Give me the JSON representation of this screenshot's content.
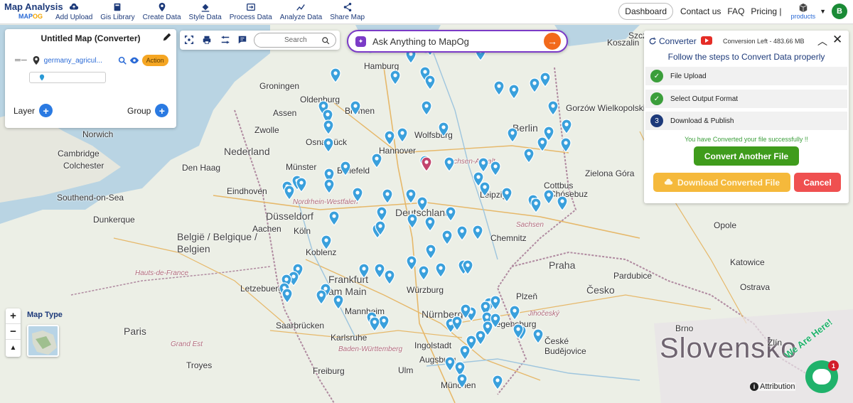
{
  "brand": {
    "title": "Map Analysis",
    "sub_prefix": "MAP",
    "sub_suffix": "OG"
  },
  "nav": [
    {
      "label": "Add Upload",
      "icon": "cloud-upload-icon"
    },
    {
      "label": "Gis Library",
      "icon": "library-icon"
    },
    {
      "label": "Create Data",
      "icon": "location-pin-icon"
    },
    {
      "label": "Style Data",
      "icon": "paint-bucket-icon"
    },
    {
      "label": "Process Data",
      "icon": "process-icon"
    },
    {
      "label": "Analyze Data",
      "icon": "analyze-icon"
    },
    {
      "label": "Share Map",
      "icon": "share-icon"
    }
  ],
  "right_nav": {
    "dashboard": "Dashboard",
    "contact": "Contact us",
    "faq": "FAQ",
    "pricing": "Pricing |",
    "products": "products",
    "avatar": "B"
  },
  "left_panel": {
    "title": "Untitled Map (Converter)",
    "layer_name": "germany_agricul...",
    "action_label": "Action",
    "layer_label": "Layer",
    "group_label": "Group"
  },
  "toolbar": {
    "search_placeholder": "Search"
  },
  "ask": {
    "placeholder": "Ask Anything to MapOg"
  },
  "converter": {
    "title": "Converter",
    "conversion_left": "Conversion Left - 483.66 MB",
    "subtitle": "Follow the steps to Convert Data properly",
    "steps": [
      {
        "label": "File Upload",
        "status": "done"
      },
      {
        "label": "Select Output Format",
        "status": "done"
      },
      {
        "label": "Download & Publish",
        "number": "3",
        "status": "current"
      }
    ],
    "success_message": "You have Converted your file successfully !!",
    "convert_another": "Convert Another File",
    "download": "Download Converted File",
    "cancel": "Cancel"
  },
  "map_controls": {
    "zoom_in": "+",
    "zoom_out": "−",
    "map_type": "Map Type",
    "attribution": "Attribution",
    "chat_badge": "1",
    "chat_tag": "We Are Here!"
  },
  "map_labels": [
    "Hamburg",
    "Groningen",
    "Oldenburg",
    "Bremen",
    "Assen",
    "Zwolle",
    "Norwich",
    "Nederland",
    "Osnabrück",
    "Hannover",
    "Wolfsburg",
    "Berlin",
    "Gorzów Wielkopolski",
    "Cambridge",
    "Colchester",
    "Den Haag",
    "Münster",
    "Bielefeld",
    "Sachsen-Anhalt",
    "Zielona Góra",
    "Cottbus",
    "Chósebuz",
    "Southend-on-Sea",
    "Eindhoven",
    "Düsseldorf",
    "Nordrhein-Westfalen",
    "Deutschland",
    "Leipzig",
    "Dunkerque",
    "Aachen",
    "Köln",
    "Sachsen",
    "Chemnitz",
    "België / Belgique / Belgien",
    "Koblenz",
    "Frankfurt am Main",
    "Praha",
    "Pardubice",
    "Katowice",
    "Letzebuerg",
    "Würzburg",
    "Plzeň",
    "Česko",
    "Mannheim",
    "Nürnberg",
    "Jihočeský",
    "Paris",
    "Saarbrücken",
    "Karlsruhe",
    "Ingolstadt",
    "Regensburg",
    "České Budějovice",
    "Baden-Württemberg",
    "Augsburg",
    "Freiburg",
    "Ulm",
    "München",
    "Slovensko",
    "Ostrava",
    "Opole",
    "Hauts-de-France",
    "Grand Est",
    "Szczecin",
    "Koszalin",
    "Brno",
    "Zlín",
    "Troyes"
  ]
}
